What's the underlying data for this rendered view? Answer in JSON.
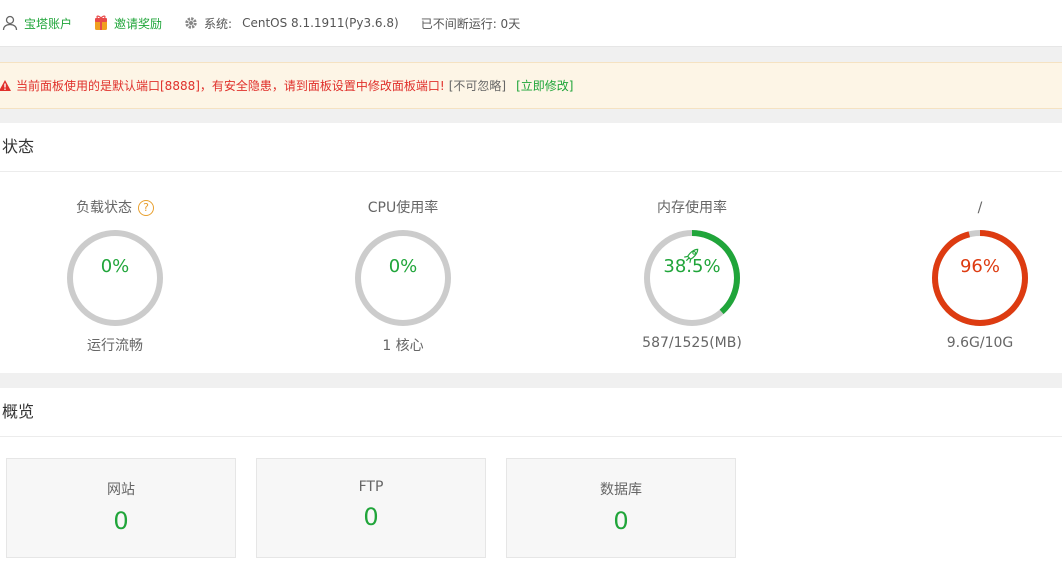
{
  "topbar": {
    "account": "宝塔账户",
    "invite": "邀请奖励",
    "system_label": "系统:",
    "system_value": "CentOS 8.1.1911(Py3.6.8)",
    "uptime": "已不间断运行: 0天"
  },
  "alert": {
    "message": "当前面板使用的是默认端口[8888]，有安全隐患，请到面板设置中修改面板端口!",
    "ignore": "[不可忽略]",
    "fix": "[立即修改]"
  },
  "status": {
    "title": "状态",
    "gauges": [
      {
        "title": "负载状态",
        "value": "0%",
        "percent": 0,
        "sub": "运行流畅",
        "color": "#20a53a",
        "help": "?"
      },
      {
        "title": "CPU使用率",
        "value": "0%",
        "percent": 0,
        "sub": "1 核心",
        "color": "#20a53a"
      },
      {
        "title": "内存使用率",
        "value": "38.5%",
        "percent": 38.5,
        "sub": "587/1525(MB)",
        "color": "#20a53a",
        "icon": "rocket-icon"
      },
      {
        "title": "/",
        "value": "96%",
        "percent": 96,
        "sub": "9.6G/10G",
        "color": "#dd3b11"
      }
    ]
  },
  "overview": {
    "title": "概览",
    "cards": [
      {
        "label": "网站",
        "value": "0"
      },
      {
        "label": "FTP",
        "value": "0"
      },
      {
        "label": "数据库",
        "value": "0"
      }
    ]
  },
  "colors": {
    "accent": "#20a53a",
    "danger": "#dd3b11",
    "warning_bg": "#fdf5e6",
    "track": "#cccccc"
  }
}
